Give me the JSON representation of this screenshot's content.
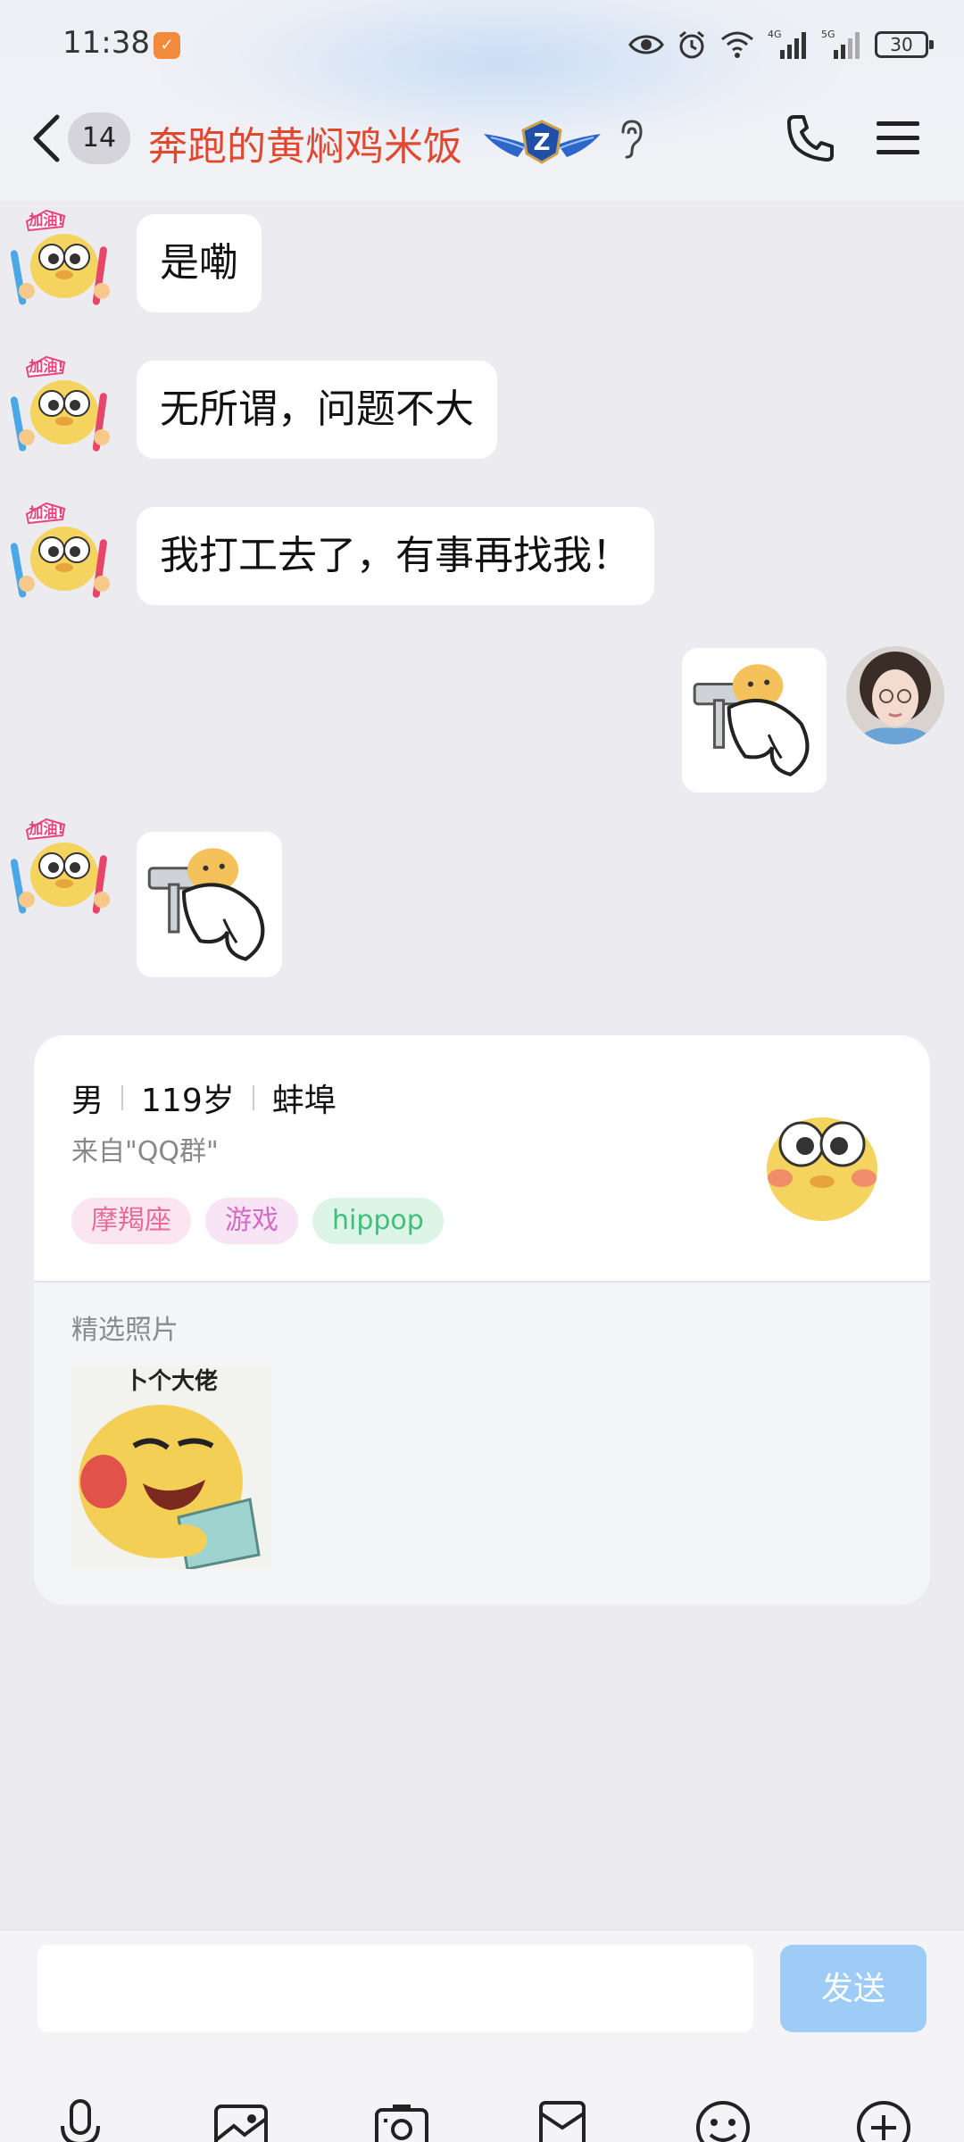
{
  "status_bar": {
    "time": "11:38",
    "app_badge": "✓",
    "battery": "30",
    "net_labels": [
      "4G",
      "5G"
    ]
  },
  "header": {
    "back_icon": "chevron-left-icon",
    "unread_count": "14",
    "title": "奔跑的黄焖鸡米饭",
    "vip_badge_text": "Z",
    "colors": {
      "title": "#e0492f",
      "accent": "#1f5fbf"
    }
  },
  "messages": [
    {
      "side": "left",
      "type": "text",
      "text": "是嘞"
    },
    {
      "side": "left",
      "type": "text",
      "text": "无所谓，问题不大"
    },
    {
      "side": "left",
      "type": "text",
      "text": "我打工去了，有事再找我！"
    },
    {
      "side": "right",
      "type": "sticker",
      "sticker": "duck-hammer-sticker"
    },
    {
      "side": "left",
      "type": "sticker",
      "sticker": "duck-hammer-sticker"
    }
  ],
  "avatar_sticker_text": "加油!",
  "profile_card": {
    "gender": "男",
    "age": "119岁",
    "location": "蚌埠",
    "from": "来自\"QQ群\"",
    "tags": [
      "摩羯座",
      "游戏",
      "hippop"
    ],
    "photos_label": "精选照片",
    "photo_caption": "卜个大佬"
  },
  "input_bar": {
    "placeholder": "",
    "send_label": "发送",
    "tools": [
      "microphone-icon",
      "image-icon",
      "camera-icon",
      "red-packet-icon",
      "emoji-icon",
      "plus-icon"
    ]
  }
}
